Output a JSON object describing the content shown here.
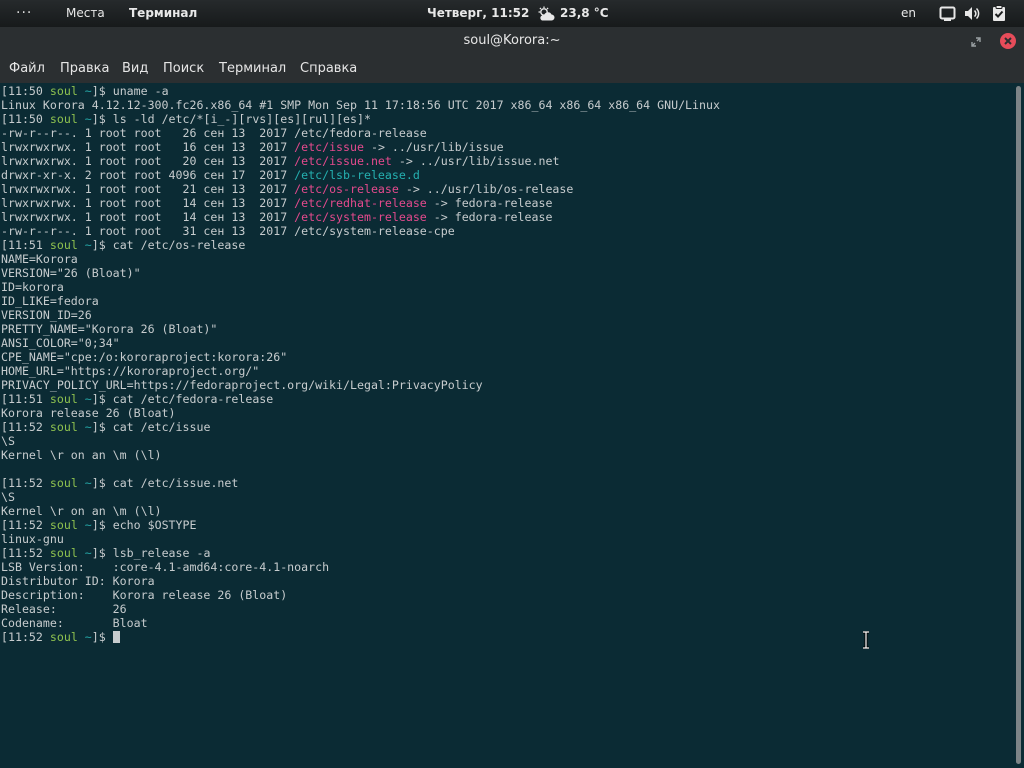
{
  "topbar": {
    "activities_glyph": "···",
    "places": "Места",
    "app": "Терминал",
    "clock": "Четверг, 11:52",
    "weather_icon": "weather-partly-cloudy-icon",
    "weather": "23,8 °C",
    "lang": "en",
    "icons": [
      "network-icon",
      "volume-icon",
      "clipboard-check-icon"
    ]
  },
  "window": {
    "title": "soul@Korora:~",
    "close_color": "#e74c5a"
  },
  "menu": [
    "Файл",
    "Правка",
    "Вид",
    "Поиск",
    "Терминал",
    "Справка"
  ],
  "colors": {
    "background": "#0b2b34",
    "text": "#c7ccce",
    "prompt_user": "#8ec14f",
    "prompt_dir": "#25a6a6",
    "symlink": "#e44a8d",
    "directory": "#25b0b0"
  },
  "terminal": {
    "lines": [
      {
        "type": "prompt",
        "time": "11:50",
        "user": "soul",
        "dir": "~",
        "cmd": "uname -a"
      },
      {
        "type": "out",
        "text": "Linux Korora 4.12.12-300.fc26.x86_64 #1 SMP Mon Sep 11 17:18:56 UTC 2017 x86_64 x86_64 x86_64 GNU/Linux"
      },
      {
        "type": "prompt",
        "time": "11:50",
        "user": "soul",
        "dir": "~",
        "cmd": "ls -ld /etc/*[i_-][rvs][es][rul][es]*"
      },
      {
        "type": "ls",
        "meta": "-rw-r--r--. 1 root root   26 сен 13  2017 ",
        "name": "/etc/fedora-release",
        "kind": "file",
        "target": ""
      },
      {
        "type": "ls",
        "meta": "lrwxrwxrwx. 1 root root   16 сен 13  2017 ",
        "name": "/etc/issue",
        "kind": "link",
        "target": " -> ../usr/lib/issue"
      },
      {
        "type": "ls",
        "meta": "lrwxrwxrwx. 1 root root   20 сен 13  2017 ",
        "name": "/etc/issue.net",
        "kind": "link",
        "target": " -> ../usr/lib/issue.net"
      },
      {
        "type": "ls",
        "meta": "drwxr-xr-x. 2 root root 4096 сен 17  2017 ",
        "name": "/etc/lsb-release.d",
        "kind": "dir",
        "target": ""
      },
      {
        "type": "ls",
        "meta": "lrwxrwxrwx. 1 root root   21 сен 13  2017 ",
        "name": "/etc/os-release",
        "kind": "link",
        "target": " -> ../usr/lib/os-release"
      },
      {
        "type": "ls",
        "meta": "lrwxrwxrwx. 1 root root   14 сен 13  2017 ",
        "name": "/etc/redhat-release",
        "kind": "link",
        "target": " -> fedora-release"
      },
      {
        "type": "ls",
        "meta": "lrwxrwxrwx. 1 root root   14 сен 13  2017 ",
        "name": "/etc/system-release",
        "kind": "link",
        "target": " -> fedora-release"
      },
      {
        "type": "ls",
        "meta": "-rw-r--r--. 1 root root   31 сен 13  2017 ",
        "name": "/etc/system-release-cpe",
        "kind": "file",
        "target": ""
      },
      {
        "type": "prompt",
        "time": "11:51",
        "user": "soul",
        "dir": "~",
        "cmd": "cat /etc/os-release"
      },
      {
        "type": "out",
        "text": "NAME=Korora"
      },
      {
        "type": "out",
        "text": "VERSION=\"26 (Bloat)\""
      },
      {
        "type": "out",
        "text": "ID=korora"
      },
      {
        "type": "out",
        "text": "ID_LIKE=fedora"
      },
      {
        "type": "out",
        "text": "VERSION_ID=26"
      },
      {
        "type": "out",
        "text": "PRETTY_NAME=\"Korora 26 (Bloat)\""
      },
      {
        "type": "out",
        "text": "ANSI_COLOR=\"0;34\""
      },
      {
        "type": "out",
        "text": "CPE_NAME=\"cpe:/o:kororaproject:korora:26\""
      },
      {
        "type": "out",
        "text": "HOME_URL=\"https://kororaproject.org/\""
      },
      {
        "type": "out",
        "text": "PRIVACY_POLICY_URL=https://fedoraproject.org/wiki/Legal:PrivacyPolicy"
      },
      {
        "type": "prompt",
        "time": "11:51",
        "user": "soul",
        "dir": "~",
        "cmd": "cat /etc/fedora-release"
      },
      {
        "type": "out",
        "text": "Korora release 26 (Bloat)"
      },
      {
        "type": "prompt",
        "time": "11:52",
        "user": "soul",
        "dir": "~",
        "cmd": "cat /etc/issue"
      },
      {
        "type": "out",
        "text": "\\S"
      },
      {
        "type": "out",
        "text": "Kernel \\r on an \\m (\\l)"
      },
      {
        "type": "out",
        "text": ""
      },
      {
        "type": "prompt",
        "time": "11:52",
        "user": "soul",
        "dir": "~",
        "cmd": "cat /etc/issue.net"
      },
      {
        "type": "out",
        "text": "\\S"
      },
      {
        "type": "out",
        "text": "Kernel \\r on an \\m (\\l)"
      },
      {
        "type": "prompt",
        "time": "11:52",
        "user": "soul",
        "dir": "~",
        "cmd": "echo $OSTYPE"
      },
      {
        "type": "out",
        "text": "linux-gnu"
      },
      {
        "type": "prompt",
        "time": "11:52",
        "user": "soul",
        "dir": "~",
        "cmd": "lsb_release -a"
      },
      {
        "type": "out",
        "text": "LSB Version:    :core-4.1-amd64:core-4.1-noarch"
      },
      {
        "type": "out",
        "text": "Distributor ID: Korora"
      },
      {
        "type": "out",
        "text": "Description:    Korora release 26 (Bloat)"
      },
      {
        "type": "out",
        "text": "Release:        26"
      },
      {
        "type": "out",
        "text": "Codename:       Bloat"
      },
      {
        "type": "prompt",
        "time": "11:52",
        "user": "soul",
        "dir": "~",
        "cmd": "",
        "cursor": true
      }
    ]
  }
}
